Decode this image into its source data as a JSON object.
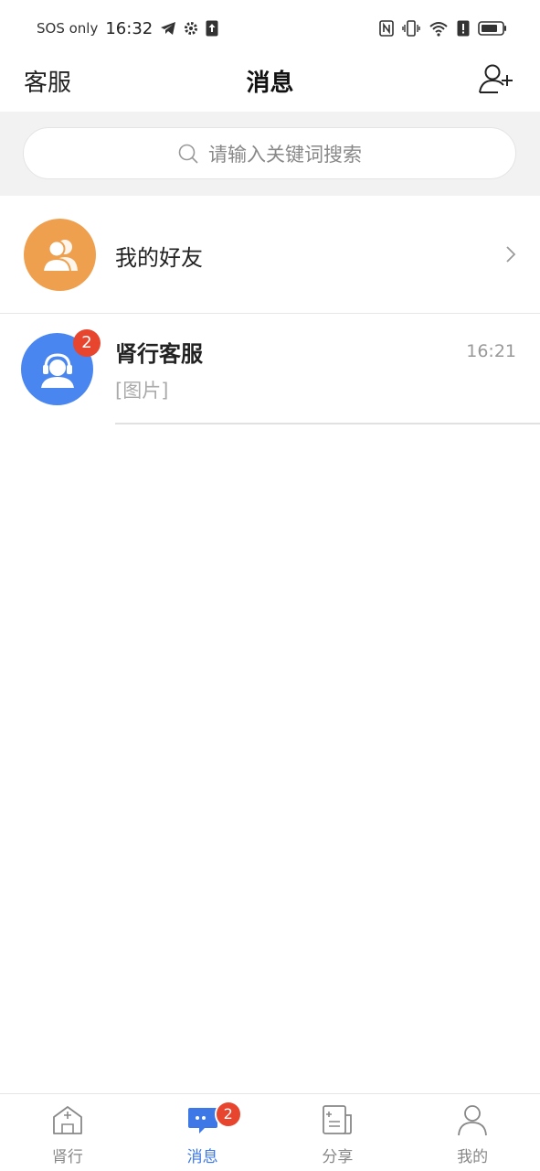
{
  "status_bar": {
    "carrier": "SOS only",
    "time": "16:32"
  },
  "header": {
    "left_label": "客服",
    "title": "消息"
  },
  "search": {
    "placeholder": "请输入关键词搜索"
  },
  "friends": {
    "label": "我的好友"
  },
  "chats": [
    {
      "name": "肾行客服",
      "time": "16:21",
      "preview": "[图片]",
      "unread": "2"
    }
  ],
  "bottom_nav": {
    "items": [
      {
        "label": "肾行",
        "icon": "home-plus-icon"
      },
      {
        "label": "消息",
        "icon": "chat-icon",
        "badge": "2",
        "active": true
      },
      {
        "label": "分享",
        "icon": "share-doc-icon"
      },
      {
        "label": "我的",
        "icon": "person-icon"
      }
    ]
  },
  "colors": {
    "accent": "#3d78e6",
    "badge": "#e8452f",
    "friends_avatar": "#efa04e",
    "service_avatar": "#4a86f0"
  }
}
